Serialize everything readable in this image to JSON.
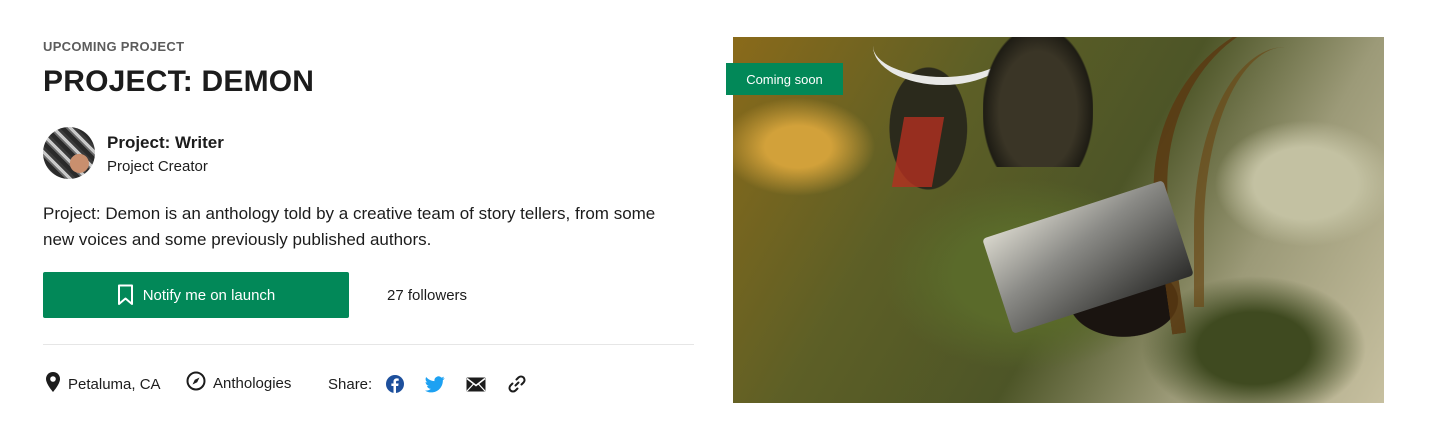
{
  "project": {
    "eyebrow": "UPCOMING PROJECT",
    "title": "PROJECT: DEMON",
    "description": "Project: Demon is an anthology told by a creative team of story tellers, from some new voices and some previously published authors."
  },
  "creator": {
    "name": "Project: Writer",
    "role": "Project Creator",
    "avatar_icon": "keyboard-photo-avatar"
  },
  "actions": {
    "notify_label": "Notify me on launch",
    "notify_icon": "bookmark-icon",
    "followers": "27 followers"
  },
  "meta": {
    "location": "Petaluma, CA",
    "location_icon": "location-pin-icon",
    "category": "Anthologies",
    "category_icon": "compass-icon",
    "share_label": "Share:",
    "share_icons": [
      "facebook-icon",
      "twitter-icon",
      "email-icon",
      "link-icon"
    ]
  },
  "hero": {
    "badge": "Coming soon",
    "image_subject": "demon-reading-book-illustration"
  },
  "colors": {
    "accent_green": "#028858",
    "text_dark": "#1c1c1c",
    "eyebrow_grey": "#5c5c5c",
    "facebook_blue": "#1d4f9c",
    "twitter_blue": "#1da1f2",
    "divider": "#e6e6e6"
  }
}
